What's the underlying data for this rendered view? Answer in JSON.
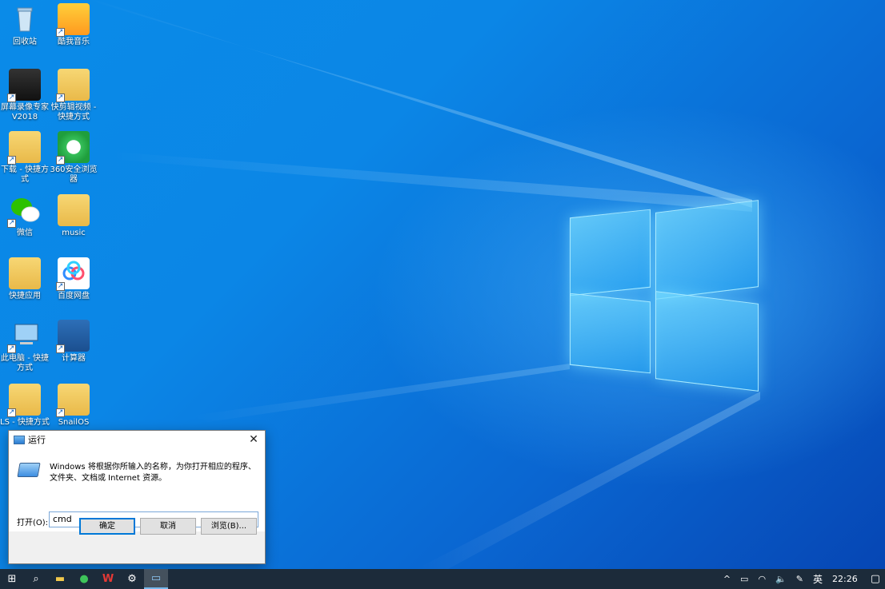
{
  "desktop": {
    "icons": [
      {
        "label": "回收站",
        "icon": "recycle-bin-icon"
      },
      {
        "label": "酷我音乐",
        "icon": "kuwo-music-icon"
      },
      {
        "label": "屏幕录像专家 V2018",
        "icon": "screen-recorder-icon"
      },
      {
        "label": "快剪辑视频 - 快捷方式",
        "icon": "folder-icon"
      },
      {
        "label": "下载 - 快捷方式",
        "icon": "folder-icon"
      },
      {
        "label": "360安全浏览器",
        "icon": "browser-360-icon"
      },
      {
        "label": "微信",
        "icon": "wechat-icon"
      },
      {
        "label": "music",
        "icon": "folder-icon"
      },
      {
        "label": "快捷应用",
        "icon": "folder-icon"
      },
      {
        "label": "百度网盘",
        "icon": "baidu-netdisk-icon"
      },
      {
        "label": "此电脑 - 快捷方式",
        "icon": "computer-icon"
      },
      {
        "label": "计算器",
        "icon": "calculator-icon"
      },
      {
        "label": "LS - 快捷方式",
        "icon": "folder-icon"
      },
      {
        "label": "SnailOS",
        "icon": "folder-icon"
      }
    ]
  },
  "run_dialog": {
    "title": "运行",
    "close_glyph": "✕",
    "description": "Windows 将根据你所输入的名称，为你打开相应的程序、文件夹、文档或 Internet 资源。",
    "open_label": "打开(O):",
    "input_value": "cmd",
    "dropdown_glyph": "⌵",
    "ok_label": "确定",
    "cancel_label": "取消",
    "browse_label": "浏览(B)..."
  },
  "taskbar": {
    "start_glyph": "⊞",
    "search_glyph": "⌕",
    "apps": [
      {
        "name": "file-explorer",
        "glyph": "▬"
      },
      {
        "name": "browser-360",
        "glyph": "●"
      },
      {
        "name": "wps",
        "glyph": "W"
      },
      {
        "name": "settings",
        "glyph": "⚙"
      },
      {
        "name": "run",
        "glyph": "▭"
      }
    ],
    "tray": {
      "chevron": "^",
      "battery": "▭",
      "wifi": "◠",
      "volume": "🔈",
      "pen": "✎",
      "ime": "英",
      "time": "22:26",
      "notification": "▢"
    }
  },
  "colors": {
    "wallpaper_main": "#0a8be8",
    "wallpaper_dark": "#0646b4",
    "taskbar": "#1c2b3a",
    "accent": "#0078d7"
  }
}
